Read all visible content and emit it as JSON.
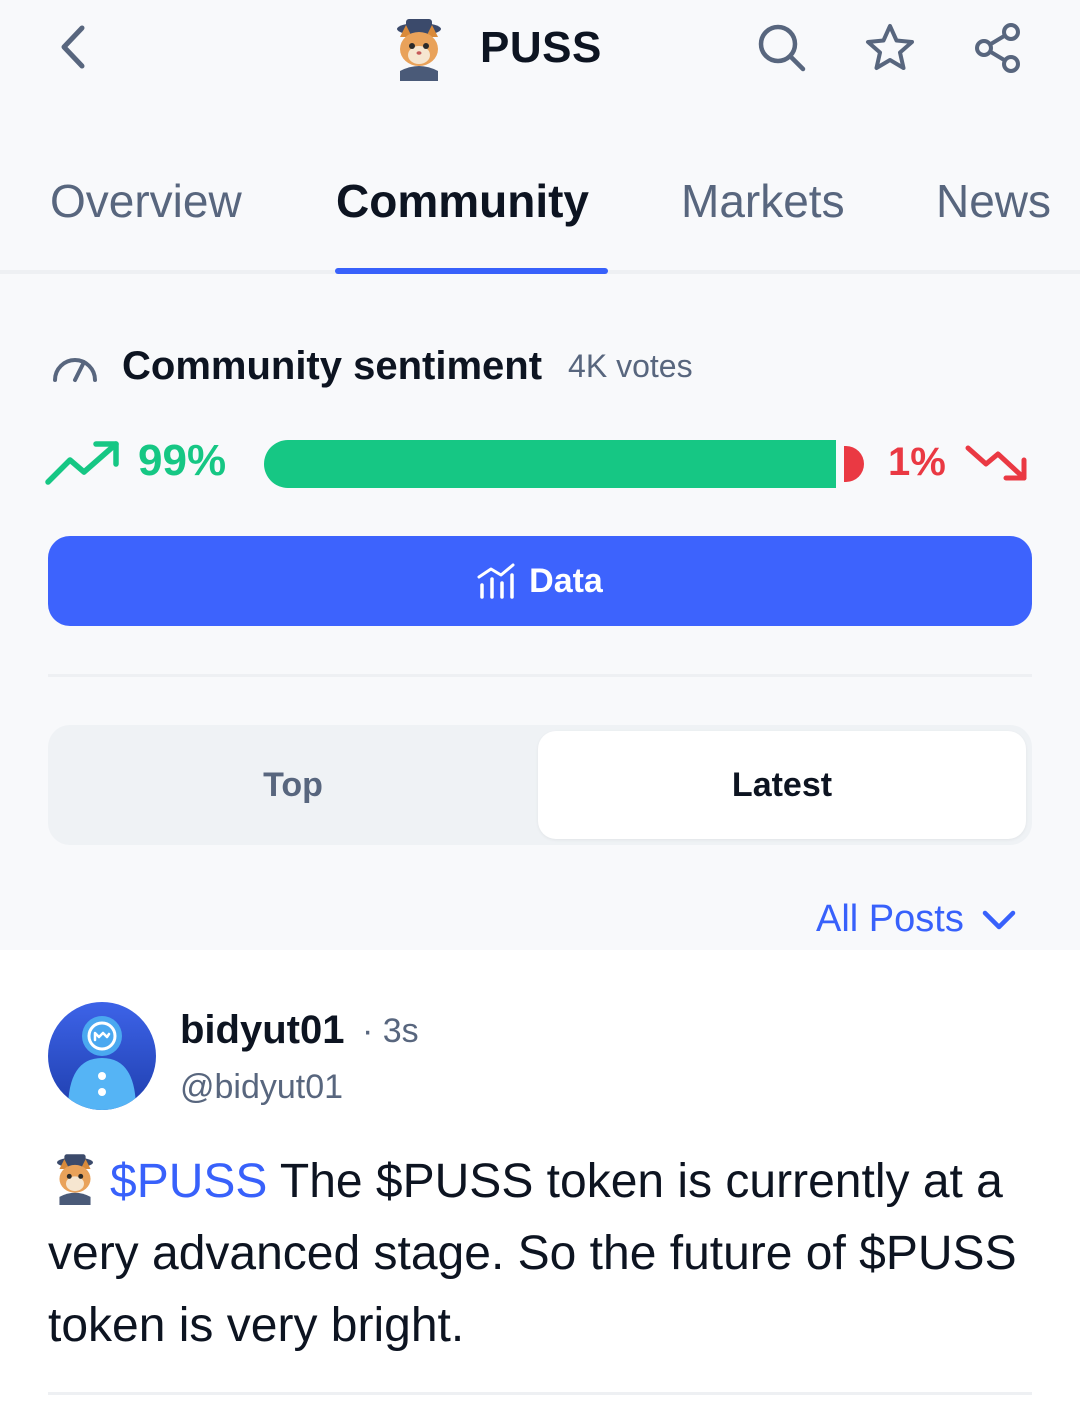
{
  "header": {
    "title": "PUSS",
    "icons": [
      "back-chevron-icon",
      "token-logo-icon",
      "search-icon",
      "star-icon",
      "share-icon"
    ]
  },
  "tabs": [
    {
      "label": "Overview",
      "active": false
    },
    {
      "label": "Community",
      "active": true
    },
    {
      "label": "Markets",
      "active": false
    },
    {
      "label": "News",
      "active": false
    }
  ],
  "sentiment": {
    "title": "Community sentiment",
    "votes": "4K votes",
    "bullish_pct": "99%",
    "bearish_pct": "1%",
    "bullish_fraction": 0.99,
    "colors": {
      "bullish": "#16c784",
      "bearish": "#ea3943"
    }
  },
  "data_button": {
    "label": "Data"
  },
  "segment": {
    "top": "Top",
    "latest": "Latest",
    "selected": "Latest"
  },
  "filter": {
    "label": "All Posts"
  },
  "post": {
    "username": "bidyut01",
    "time": "· 3s",
    "handle": "@bidyut01",
    "cashtag": "$PUSS",
    "text": " The $PUSS token is currently at a very advanced stage. So the future of $PUSS token is very bright."
  },
  "accent_color": "#3861fb"
}
